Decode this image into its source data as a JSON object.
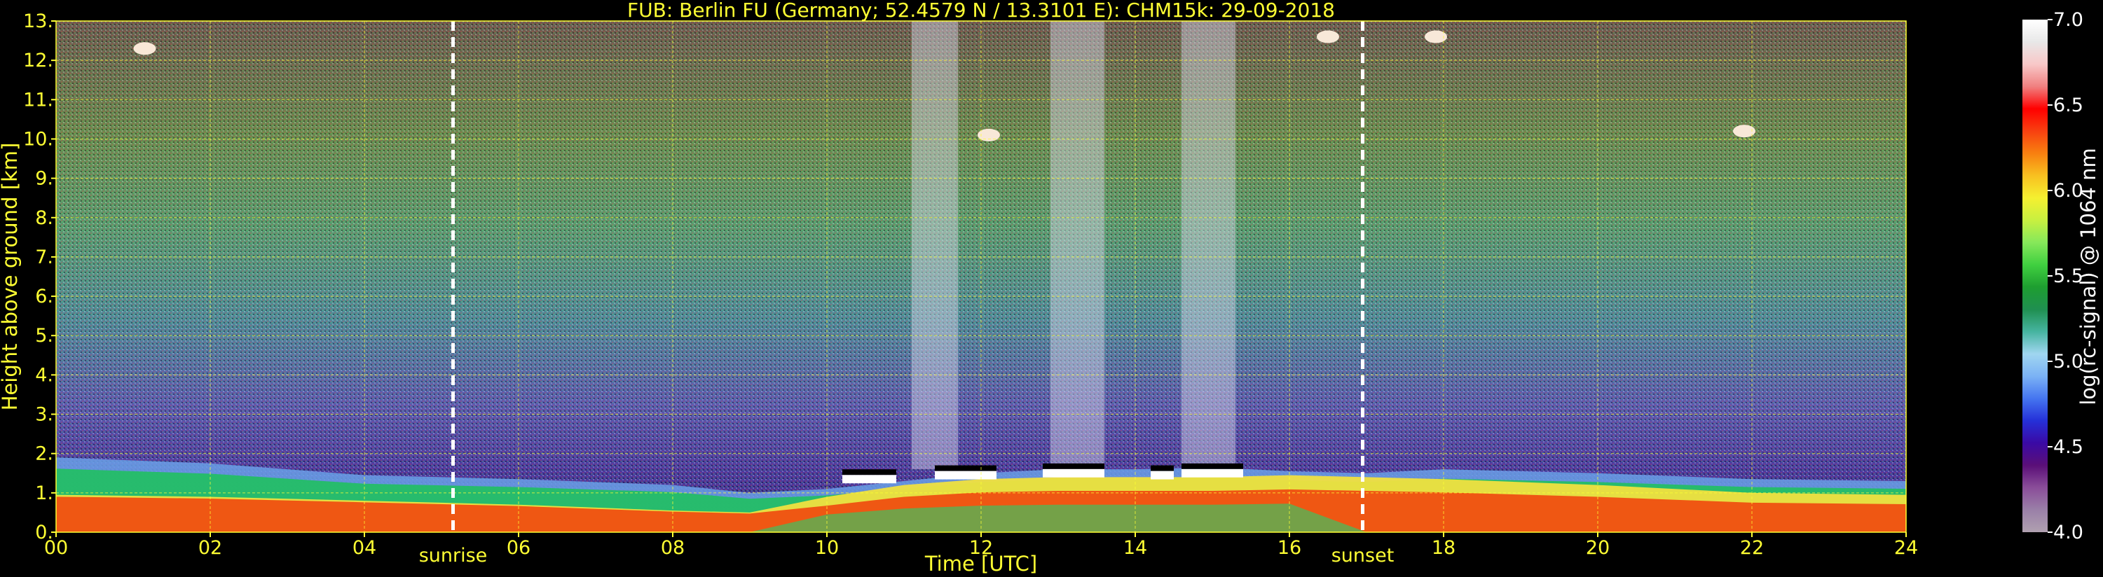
{
  "chart_data": {
    "type": "heatmap",
    "title": "FUB: Berlin FU (Germany; 52.4579 N / 13.3101 E):    CHM15k: 29-09-2018",
    "xlabel": "Time [UTC]",
    "ylabel": "Height above ground [km]",
    "xlim": [
      0,
      24
    ],
    "ylim": [
      0,
      13
    ],
    "x_ticks": [
      "00",
      "02",
      "04",
      "06",
      "08",
      "10",
      "12",
      "14",
      "16",
      "18",
      "20",
      "22",
      "24"
    ],
    "y_ticks": [
      "0.",
      "1.",
      "2.",
      "3.",
      "4.",
      "5.",
      "6.",
      "7.",
      "8.",
      "9.",
      "10.",
      "11.",
      "12.",
      "13."
    ],
    "grid": true,
    "colorbar": {
      "label": "log(rc-signal) @ 1064 nm",
      "range": [
        4.0,
        7.0
      ],
      "ticks": [
        "4.0",
        "4.5",
        "5.0",
        "5.5",
        "6.0",
        "6.5",
        "7.0"
      ],
      "colors": [
        "#b0a0b0",
        "#9a80a8",
        "#8a4d99",
        "#5a0f78",
        "#3a0aa5",
        "#2530d8",
        "#4575f0",
        "#7bb2f5",
        "#a0d6f0",
        "#46b4a0",
        "#1f8f50",
        "#1e9e30",
        "#40d040",
        "#86e85a",
        "#c8f040",
        "#f5f030",
        "#f8c020",
        "#f88010",
        "#f84010",
        "#ff0000",
        "#f08080",
        "#f8c8c8",
        "#e8e8e8",
        "#ffffff"
      ]
    },
    "events": [
      {
        "label": "sunrise",
        "time": 5.15
      },
      {
        "label": "sunset",
        "time": 16.95
      }
    ],
    "boundary_layer": {
      "time": [
        0,
        2,
        4,
        6,
        8,
        9,
        10,
        11,
        12,
        13,
        14,
        15,
        16,
        17,
        18,
        20,
        22,
        24
      ],
      "aerosol_top_km": [
        1.9,
        1.75,
        1.45,
        1.35,
        1.2,
        1.0,
        1.1,
        1.3,
        1.5,
        1.6,
        1.6,
        1.65,
        1.55,
        1.5,
        1.6,
        1.5,
        1.35,
        1.3
      ],
      "dense_top_km": [
        0.95,
        0.9,
        0.8,
        0.7,
        0.55,
        0.5,
        0.9,
        1.2,
        1.35,
        1.4,
        1.4,
        1.4,
        1.45,
        1.4,
        1.35,
        1.2,
        1.0,
        0.95
      ]
    },
    "cloud_base_segments": [
      {
        "start": 10.2,
        "end": 10.9,
        "height_km": 1.35
      },
      {
        "start": 11.4,
        "end": 12.2,
        "height_km": 1.45
      },
      {
        "start": 12.8,
        "end": 13.6,
        "height_km": 1.5
      },
      {
        "start": 14.2,
        "end": 14.5,
        "height_km": 1.45
      },
      {
        "start": 14.6,
        "end": 15.4,
        "height_km": 1.5
      }
    ],
    "precipitation_streaks": [
      {
        "start": 11.1,
        "end": 11.7
      },
      {
        "start": 12.9,
        "end": 13.6
      },
      {
        "start": 14.6,
        "end": 15.3
      }
    ],
    "cirrus_patches": [
      {
        "time": 1.15,
        "height_km": 12.3
      },
      {
        "time": 12.1,
        "height_km": 10.1
      },
      {
        "time": 21.9,
        "height_km": 10.2
      },
      {
        "time": 16.5,
        "height_km": 12.6
      },
      {
        "time": 17.9,
        "height_km": 12.6
      }
    ]
  }
}
